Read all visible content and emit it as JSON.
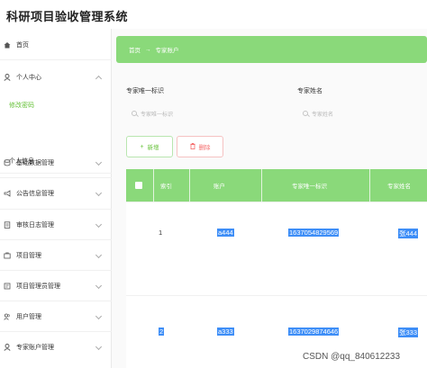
{
  "app": {
    "title": "科研项目验收管理系统"
  },
  "sidebar": {
    "items": [
      {
        "label": "首页",
        "icon": "home-icon"
      },
      {
        "label": "个人中心",
        "icon": "user-icon",
        "expanded": true,
        "children": [
          {
            "label": "修改密码",
            "active": true
          },
          {
            "label": "个人信息"
          }
        ]
      },
      {
        "label": "基础数据管理",
        "icon": "database-icon"
      },
      {
        "label": "公告信息管理",
        "icon": "notice-icon"
      },
      {
        "label": "审核日志管理",
        "icon": "log-icon"
      },
      {
        "label": "项目管理",
        "icon": "project-icon"
      },
      {
        "label": "项目管理员管理",
        "icon": "admin-icon"
      },
      {
        "label": "用户管理",
        "icon": "users-icon"
      },
      {
        "label": "专家账户管理",
        "icon": "expert-icon"
      }
    ]
  },
  "breadcrumb": {
    "home": "首页",
    "separator": "→",
    "current": "专家账户"
  },
  "search": {
    "id_label": "专家唯一标识",
    "id_placeholder": "专家唯一标识",
    "name_label": "专家姓名",
    "name_placeholder": "专家姓名"
  },
  "actions": {
    "add_label": "新增",
    "delete_label": "删除"
  },
  "table": {
    "headers": [
      "索引",
      "账户",
      "专家唯一标识",
      "专家姓名"
    ],
    "rows": [
      {
        "index": "1",
        "account": "a444",
        "expert_id": "1637054829569",
        "name": "张444"
      },
      {
        "index": "2",
        "account": "a333",
        "expert_id": "1637029874646",
        "name": "张333"
      }
    ]
  },
  "watermark": "CSDN @qq_840612233",
  "colors": {
    "accent": "#8ad97a",
    "accent_text": "#67c23a",
    "danger": "#f56c6c",
    "selection": "#3e8ef7"
  }
}
